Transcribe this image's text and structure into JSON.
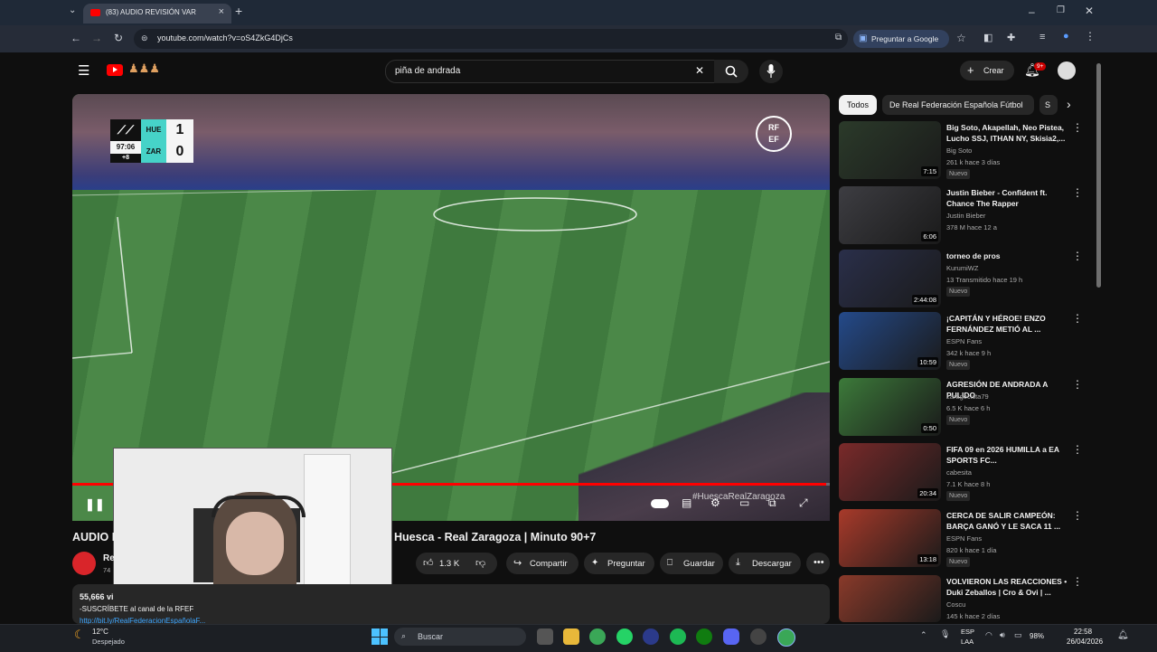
{
  "browser": {
    "tab_title": "(83) AUDIO REVISIÓN VAR",
    "url": "youtube.com/watch?v=oS4ZkG4DjCs",
    "ask_google": "Preguntar a Google"
  },
  "youtube": {
    "search_query": "piña de andrada",
    "create_label": "Crear",
    "notif_count": "9+"
  },
  "video": {
    "scorebug": {
      "home": "HUE",
      "away": "ZAR",
      "home_score": "1",
      "away_score": "0",
      "clock": "97:06",
      "added": "+8"
    },
    "rfef_logo_line1": "RF",
    "rfef_logo_line2": "EF",
    "watermark": "#HuescaRealZaragoza",
    "progress": 0.995,
    "title_left": "AUDIO I",
    "title_right": "Huesca - Real Zaragoza | Minuto 90+7",
    "channel_fragment": "Re",
    "subs_fragment": "74",
    "likes": "1.3 K",
    "share": "Compartir",
    "ask": "Preguntar",
    "save": "Guardar",
    "download": "Descargar",
    "views_fragment": "55,666 vi",
    "desc_line1": "-SUSCRÍBETE al canal de la RFEF",
    "desc_line2": "http://bit.ly/RealFederacionEspañolaF..."
  },
  "sidebar": {
    "chips": [
      "Todos",
      "De Real Federación Española Fútbol",
      "S"
    ],
    "recommendations": [
      {
        "title": "Big Soto, Akapellah, Neo Pistea, Lucho SSJ, ITHAN NY, Skisia2,...",
        "channel": "Big Soto",
        "meta": "261 k   hace 3 días",
        "badge": "Nuevo",
        "duration": "7:15",
        "color": "#2b3a2a"
      },
      {
        "title": "Justin Bieber - Confident ft. Chance The Rapper",
        "channel": "Justin Bieber",
        "meta": "378 M   hace 12 a",
        "badge": "",
        "duration": "6:06",
        "color": "#3d3d42"
      },
      {
        "title": "torneo de pros",
        "channel": "KurumiWZ",
        "meta": "13   Transmitido hace 19 h",
        "badge": "Nuevo",
        "duration": "2:44:08",
        "color": "#2a2f4a"
      },
      {
        "title": "¡CAPITÁN Y HÉROE! ENZO FERNÁNDEZ METIÓ AL ...",
        "channel": "ESPN Fans",
        "meta": "342 k   hace 9 h",
        "badge": "Nuevo",
        "duration": "10:59",
        "color": "#244a8a"
      },
      {
        "title": "AGRESIÓN DE ANDRADA A PULIDO",
        "channel": "zaragocista79",
        "meta": "6.5 K   hace 6 h",
        "badge": "Nuevo",
        "duration": "0:50",
        "color": "#3c7a3a"
      },
      {
        "title": "FIFA 09 en 2026 HUMILLA a EA SPORTS FC...",
        "channel": "cabesita",
        "meta": "7.1 K   hace 8 h",
        "badge": "Nuevo",
        "duration": "20:34",
        "color": "#7a2a2a"
      },
      {
        "title": "CERCA DE SALIR CAMPEÓN: BARÇA GANÓ Y LE SACA 11 ...",
        "channel": "ESPN Fans",
        "meta": "820 k   hace 1 día",
        "badge": "Nuevo",
        "duration": "13:18",
        "color": "#a83a2a"
      },
      {
        "title": "VOLVIERON LAS REACCIONES • Duki Zeballos | Cro & Ovi | ...",
        "channel": "Coscu",
        "meta": "145 k   hace 2 días",
        "badge": "",
        "duration": "",
        "color": "#8a3a2a"
      }
    ]
  },
  "taskbar": {
    "temp": "12°C",
    "weather": "Despejado",
    "search": "Buscar",
    "lang1": "ESP",
    "lang2": "LAA",
    "battery": "98%",
    "time": "22:58",
    "date": "26/04/2026"
  }
}
